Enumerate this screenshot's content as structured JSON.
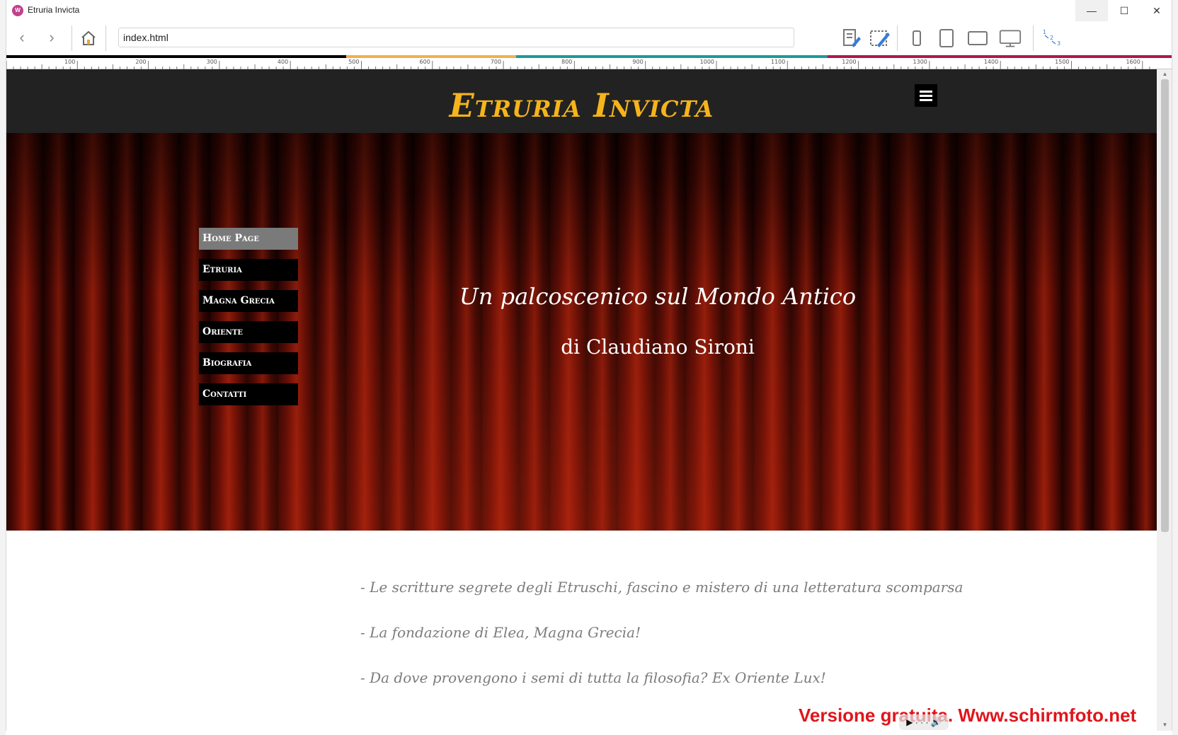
{
  "window": {
    "title": "Etruria Invicta",
    "app_icon": "W"
  },
  "window_controls": {
    "minimize": "—",
    "maximize": "☐",
    "close": "✕"
  },
  "toolbar": {
    "back_glyph": "‹",
    "forward_glyph": "›",
    "url": "index.html"
  },
  "breakpoints": [
    {
      "color": "#000000"
    },
    {
      "color": "#f2b04a"
    },
    {
      "color": "#1d9a96"
    },
    {
      "color": "#b0164e"
    }
  ],
  "ruler": {
    "labels": [
      "100",
      "200",
      "300",
      "400",
      "500",
      "600",
      "700",
      "800",
      "900",
      "1000",
      "1100",
      "1200",
      "1300",
      "1400",
      "1500",
      "1600"
    ]
  },
  "site": {
    "title": "Etruria Invicta",
    "title_color": "#f6b41b",
    "header_bg": "#222222"
  },
  "hero": {
    "menu": [
      {
        "label": "Home Page",
        "active": true
      },
      {
        "label": "Etruria",
        "active": false
      },
      {
        "label": "Magna Grecia",
        "active": false
      },
      {
        "label": "Oriente",
        "active": false
      },
      {
        "label": "Biografia",
        "active": false
      },
      {
        "label": "Contatti",
        "active": false
      }
    ],
    "tagline": "Un palcoscenico sul Mondo Antico",
    "author": "di Claudiano Sironi"
  },
  "articles": [
    "- Le scritture segrete degli Etruschi, fascino e mistero di una letteratura scomparsa",
    "- La fondazione di Elea, Magna Grecia!",
    "- Da dove provengono i semi di tutta la filosofia? Ex Oriente Lux!"
  ],
  "watermark": "Versione gratuita. Www.schirmfoto.net",
  "media_controls": "▶ · · · 🔊"
}
